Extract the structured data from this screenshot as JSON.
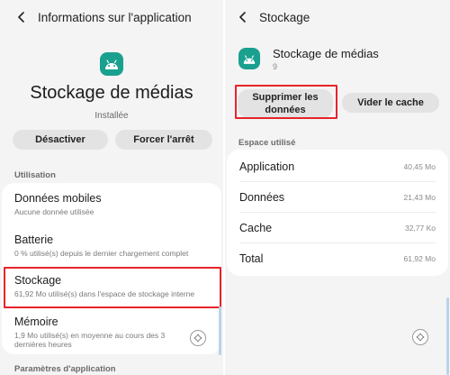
{
  "left_screen": {
    "header_title": "Informations sur l'application",
    "app_name": "Stockage de médias",
    "app_status": "Installée",
    "buttons": {
      "disable": "Désactiver",
      "force_stop": "Forcer l'arrêt"
    },
    "usage_section": "Utilisation",
    "items": [
      {
        "title": "Données mobiles",
        "subtitle": "Aucune donnée utilisée"
      },
      {
        "title": "Batterie",
        "subtitle": "0 % utilisé(s) depuis le dernier chargement complet"
      },
      {
        "title": "Stockage",
        "subtitle": "61,92 Mo utilisé(s) dans l'espace de stockage interne"
      },
      {
        "title": "Mémoire",
        "subtitle": "1,9 Mo utilisé(s) en moyenne au cours des 3 dernières heures"
      }
    ],
    "app_settings_section": "Paramètres d'application"
  },
  "right_screen": {
    "header_title": "Stockage",
    "app_name": "Stockage de médias",
    "app_count": "9",
    "buttons": {
      "clear_data": "Supprimer les données",
      "clear_cache": "Vider le cache"
    },
    "space_section": "Espace utilisé",
    "rows": [
      {
        "label": "Application",
        "value": "40,45 Mo"
      },
      {
        "label": "Données",
        "value": "21,43 Mo"
      },
      {
        "label": "Cache",
        "value": "32,77 Ko"
      },
      {
        "label": "Total",
        "value": "61,92 Mo"
      }
    ]
  },
  "colors": {
    "highlight": "#e8232a",
    "app_icon_bg": "#1aa08f"
  },
  "icons": [
    "chevron-left-icon",
    "android-app-icon",
    "floating-navigation-icon"
  ]
}
